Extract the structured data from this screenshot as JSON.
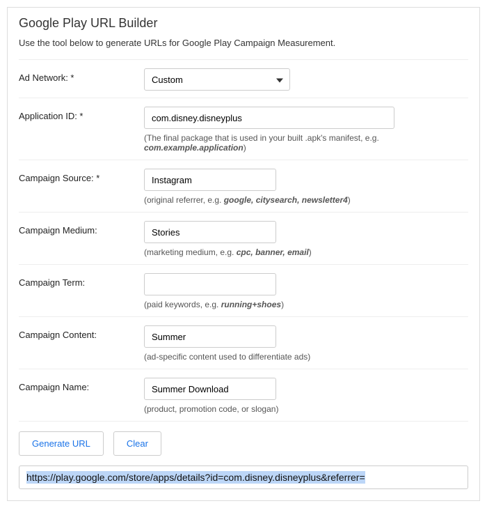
{
  "title": "Google Play URL Builder",
  "subtitle": "Use the tool below to generate URLs for Google Play Campaign Measurement.",
  "rows": {
    "adNetwork": {
      "label": "Ad Network: *",
      "value": "Custom"
    },
    "appId": {
      "label": "Application ID: *",
      "value": "com.disney.disneyplus",
      "hintPrefix": "(The final package that is used in your built .apk's manifest, e.g. ",
      "hintEm": "com.example.application",
      "hintSuffix": ")"
    },
    "source": {
      "label": "Campaign Source: *",
      "value": "Instagram",
      "hintPrefix": "(original referrer, e.g. ",
      "hintEm": "google, citysearch, newsletter4",
      "hintSuffix": ")"
    },
    "medium": {
      "label": "Campaign Medium:",
      "value": "Stories",
      "hintPrefix": "(marketing medium, e.g. ",
      "hintEm": "cpc, banner, email",
      "hintSuffix": ")"
    },
    "term": {
      "label": "Campaign Term:",
      "value": "",
      "hintPrefix": "(paid keywords, e.g. ",
      "hintEm": "running+shoes",
      "hintSuffix": ")"
    },
    "content": {
      "label": "Campaign Content:",
      "value": "Summer",
      "hint": "(ad-specific content used to differentiate ads)"
    },
    "name": {
      "label": "Campaign Name:",
      "value": "Summer Download",
      "hint": "(product, promotion code, or slogan)"
    }
  },
  "buttons": {
    "generate": "Generate URL",
    "clear": "Clear"
  },
  "resultUrl": "https://play.google.com/store/apps/details?id=com.disney.disneyplus&referrer="
}
